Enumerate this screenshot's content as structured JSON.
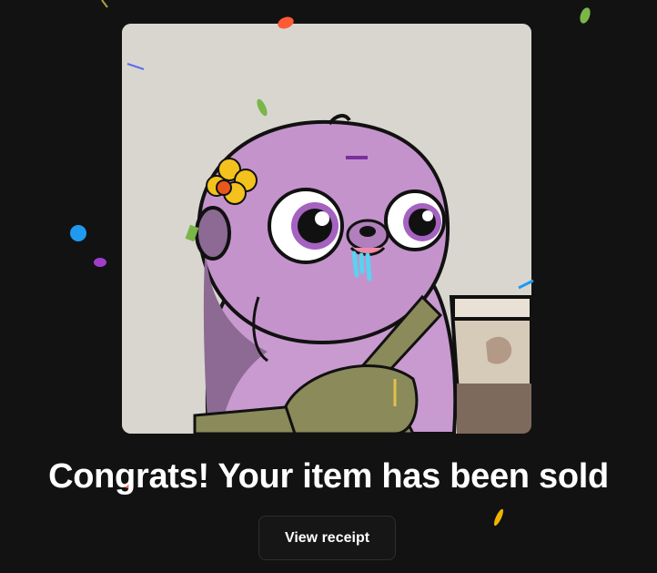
{
  "dialog": {
    "headline": "Congrats! Your item has been sold",
    "view_receipt_label": "View receipt"
  },
  "nft": {
    "subject": "purple sloth with flower and coffee cup",
    "background_color": "#d9d6cf"
  },
  "colors": {
    "page_background": "#121212",
    "button_border": "#2e2e2e",
    "text": "#ffffff",
    "confetti": [
      "#ff5a36",
      "#7ab648",
      "#1e9bf0",
      "#a03ec9",
      "#f0b400",
      "#5b6ee8"
    ]
  }
}
